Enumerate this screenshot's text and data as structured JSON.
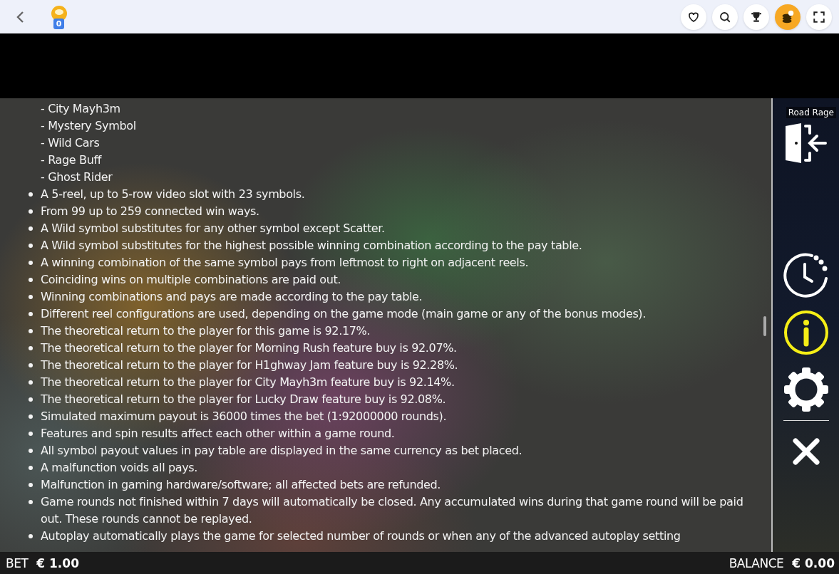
{
  "top_bar": {
    "badge_count": "0",
    "actions": [
      {
        "kind": "favorite",
        "selected": false
      },
      {
        "kind": "search",
        "selected": false
      },
      {
        "kind": "trophy",
        "selected": false
      },
      {
        "kind": "coins",
        "selected": true
      },
      {
        "kind": "fullscreen",
        "selected": false
      }
    ]
  },
  "rules": [
    {
      "kind": "sub",
      "text": "- City Mayh3m"
    },
    {
      "kind": "sub",
      "text": "- Mystery Symbol"
    },
    {
      "kind": "sub",
      "text": "- Wild Cars"
    },
    {
      "kind": "sub",
      "text": "- Rage Buff"
    },
    {
      "kind": "sub",
      "text": "- Ghost Rider"
    },
    {
      "kind": "bullet",
      "text": "A 5-reel, up to 5-row video slot with 23 symbols."
    },
    {
      "kind": "bullet",
      "text": "From 99 up to 259 connected win ways."
    },
    {
      "kind": "bullet",
      "text": "A Wild symbol substitutes for any other symbol except Scatter."
    },
    {
      "kind": "bullet",
      "text": "A Wild symbol substitutes for the highest possible winning combination according to the pay table."
    },
    {
      "kind": "bullet",
      "text": "A winning combination of the same symbol pays from leftmost to right on adjacent reels."
    },
    {
      "kind": "bullet",
      "text": "Coinciding wins on multiple combinations are paid out."
    },
    {
      "kind": "bullet",
      "text": "Winning combinations and pays are made according to the pay table."
    },
    {
      "kind": "bullet",
      "text": "Different reel configurations are used, depending on the game mode (main game or any of the bonus modes)."
    },
    {
      "kind": "bullet",
      "text": "The theoretical return to the player for this game is 92.17%."
    },
    {
      "kind": "bullet",
      "text": "The theoretical return to the player for Morning Rush feature buy is 92.07%."
    },
    {
      "kind": "bullet",
      "text": "The theoretical return to the player for H1ghway Jam feature buy is 92.28%."
    },
    {
      "kind": "bullet",
      "text": "The theoretical return to the player for City Mayh3m feature buy is 92.14%."
    },
    {
      "kind": "bullet",
      "text": "The theoretical return to the player for Lucky Draw feature buy is 92.08%."
    },
    {
      "kind": "bullet",
      "text": "Simulated maximum payout is 36000 times the bet (1:92000000 rounds)."
    },
    {
      "kind": "bullet",
      "text": "Features and spin results affect each other within a game round."
    },
    {
      "kind": "bullet",
      "text": "All symbol payout values in pay table are displayed in the same currency as bet placed."
    },
    {
      "kind": "bullet",
      "text": "A malfunction voids all pays."
    },
    {
      "kind": "bullet",
      "text": "Malfunction in gaming hardware/software; all affected bets are refunded."
    },
    {
      "kind": "bullet",
      "text": "Game rounds not finished within 7 days will automatically be closed. Any accumulated wins during that game round will be paid out. These rounds cannot be replayed."
    },
    {
      "kind": "bullet",
      "text": "Autoplay automatically plays the game for selected number of rounds or when any of the advanced autoplay setting"
    }
  ],
  "side_menu": {
    "title": "Road Rage",
    "items": [
      {
        "kind": "exit",
        "selected": false
      },
      {
        "kind": "history",
        "selected": false
      },
      {
        "kind": "info",
        "selected": true
      },
      {
        "kind": "settings",
        "selected": false
      },
      {
        "kind": "close",
        "selected": false
      }
    ]
  },
  "status_bar": {
    "bet_label": "BET",
    "bet": "€ 1.00",
    "balance_label": "BALANCE",
    "balance": "€ 0.00"
  }
}
